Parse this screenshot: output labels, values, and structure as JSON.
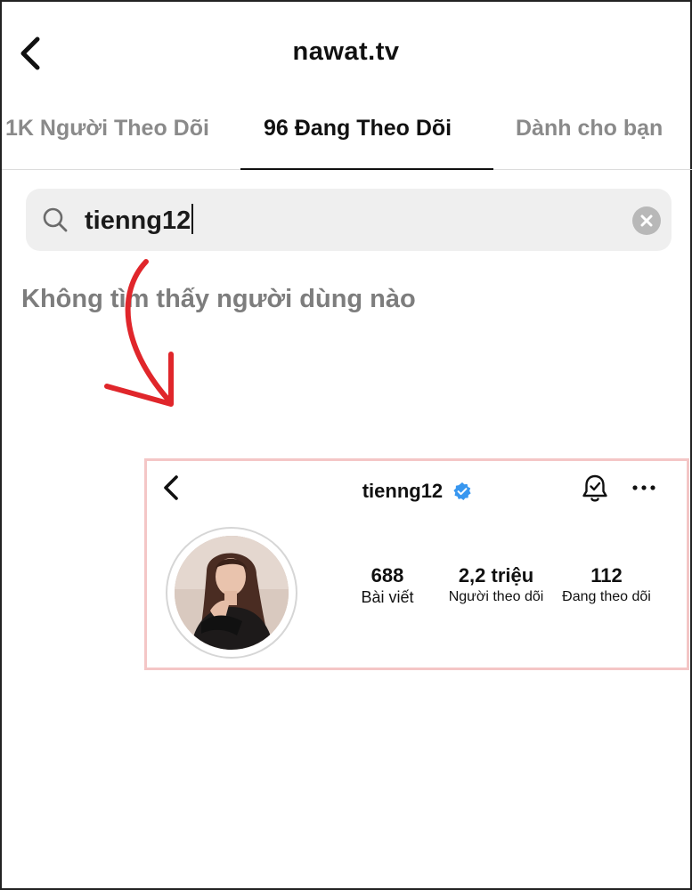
{
  "header": {
    "title": "nawat.tv",
    "back_icon": "chevron-left-icon"
  },
  "tabs": [
    {
      "label": "1K Người Theo Dõi",
      "active": false
    },
    {
      "label": "96 Đang Theo Dõi",
      "active": true
    },
    {
      "label": "Dành cho bạn",
      "active": false
    }
  ],
  "search": {
    "value": "tienng12",
    "icon": "search-icon",
    "clear_icon": "clear-icon"
  },
  "empty_state": {
    "message": "Không tìm thấy người dùng nào"
  },
  "annotation": {
    "color": "#e0262b",
    "icon": "curved-arrow-icon"
  },
  "profile_card": {
    "border_color": "#f4c6c6",
    "username": "tienng12",
    "verified": true,
    "verified_color": "#3897f0",
    "stats": [
      {
        "value": "688",
        "label": "Bài viết"
      },
      {
        "value": "2,2 triệu",
        "label": "Người theo dõi"
      },
      {
        "value": "112",
        "label": "Đang theo dõi"
      }
    ]
  }
}
